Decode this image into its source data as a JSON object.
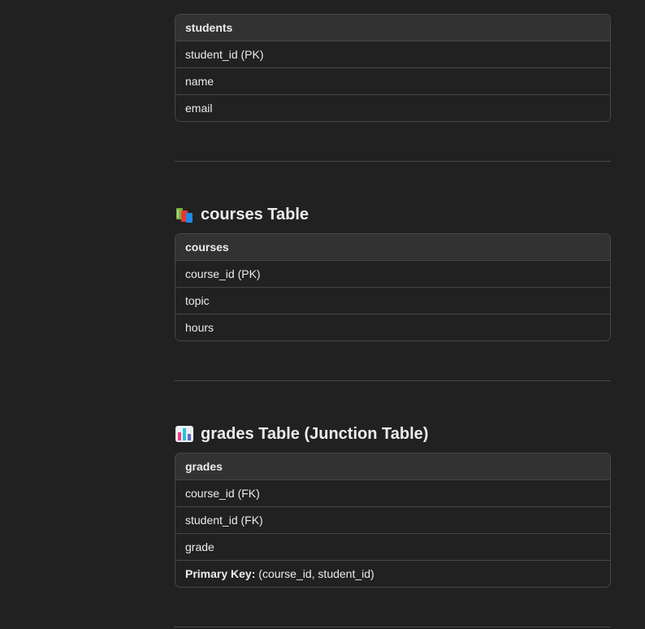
{
  "students_table": {
    "header": "students",
    "rows": [
      "student_id (PK)",
      "name",
      "email"
    ]
  },
  "courses_section": {
    "icon": "books-icon",
    "title": "courses Table",
    "table": {
      "header": "courses",
      "rows": [
        "course_id (PK)",
        "topic",
        "hours"
      ]
    }
  },
  "grades_section": {
    "icon": "bar-chart-icon",
    "title": "grades Table (Junction Table)",
    "table": {
      "header": "grades",
      "rows": [
        "course_id (FK)",
        "student_id (FK)",
        "grade"
      ],
      "pk_label": "Primary Key:",
      "pk_value": " (course_id, student_id)"
    }
  },
  "colors": {
    "background": "#212121",
    "table_header": "#323232",
    "border": "#464646",
    "text": "#ececec"
  }
}
